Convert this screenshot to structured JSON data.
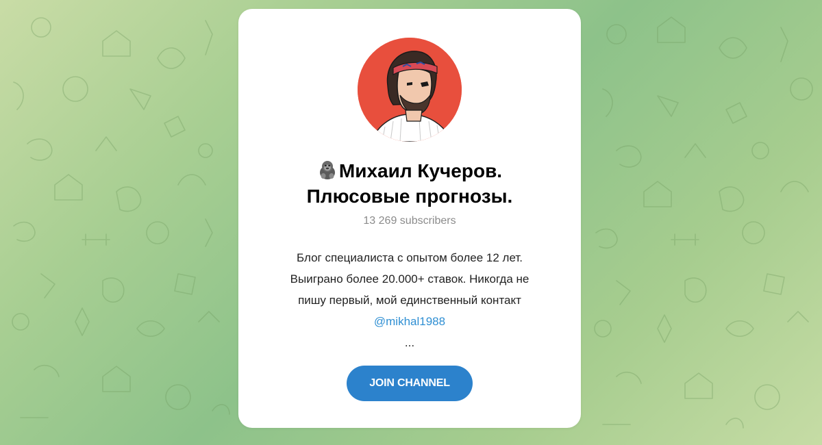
{
  "channel": {
    "name_line1": "Михаил Кучеров.",
    "name_line2": "Плюсовые прогнозы.",
    "title_emoji": "gorilla-icon",
    "subscribers": "13 269 subscribers",
    "description": {
      "line1": "Блог специалиста с опытом более 12 лет.",
      "line2": "Выиграно более 20.000+ ставок. Никогда не",
      "line3": "пишу первый, мой единственный контакт",
      "contact_link": "@mikhal1988",
      "ellipsis": "..."
    },
    "avatar_icon": "player-portrait-avatar"
  },
  "actions": {
    "join_label": "JOIN CHANNEL"
  },
  "colors": {
    "button": "#2c82cc",
    "link": "#2f8fd3",
    "avatar_bg": "#e84f3d",
    "subscribers_text": "#8b8b8b"
  }
}
